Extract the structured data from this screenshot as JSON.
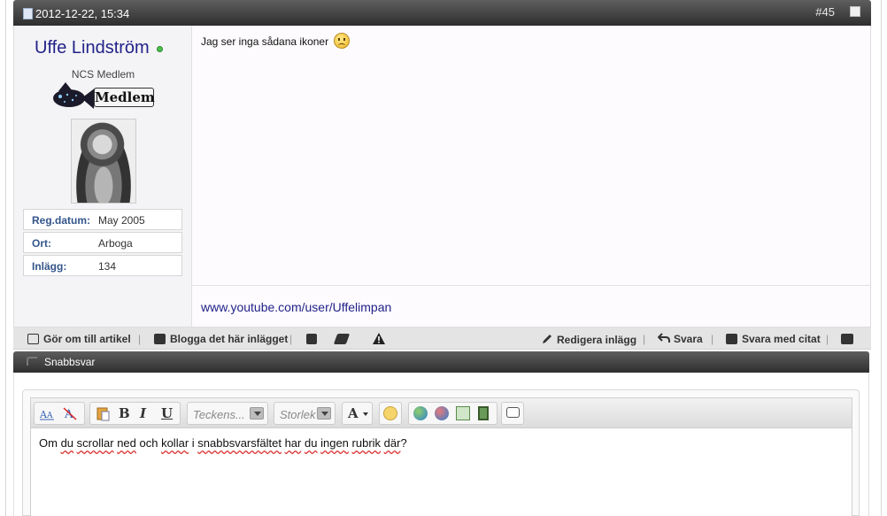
{
  "post": {
    "date": "2012-12-22, 15:34",
    "number": "#45",
    "username": "Uffe Lindström",
    "usertitle": "NCS Medlem",
    "rank_text": "Medlem",
    "stats": [
      {
        "label": "Reg.datum:",
        "value": "May 2005"
      },
      {
        "label": "Ort:",
        "value": "Arboga"
      },
      {
        "label": "Inlägg:",
        "value": "134"
      }
    ],
    "message": "Jag ser inga sådana ikoner",
    "signature_link": "www.youtube.com/user/Uffelimpan"
  },
  "actions": {
    "make_article": "Gör om till artikel",
    "blog_post": "Blogga det här inlägget",
    "edit": "Redigera inlägg",
    "reply": "Svara",
    "reply_quote": "Svara med citat"
  },
  "quick_reply": {
    "title": "Snabbsvar",
    "font_placeholder": "Teckens...",
    "size_placeholder": "Storlek",
    "text_parts": [
      "Om ",
      "du",
      " ",
      "scrollar",
      " ",
      "ned",
      " och ",
      "kollar",
      " i ",
      "snabbsvarsfältet",
      " ",
      "har",
      " ",
      "du",
      " ",
      "ingen",
      " ",
      "rubrik",
      " ",
      "där",
      "?"
    ]
  },
  "colors": {
    "header_bar": "#3f3f3f",
    "username": "#22228a",
    "stat_label": "#33558a"
  },
  "icons": [
    "document-icon",
    "checkbox-icon",
    "online-icon",
    "sad-smiley-icon",
    "article-icon",
    "blog-icon",
    "ip-icon",
    "infraction-icon",
    "warning-icon",
    "edit-icon",
    "reply-icon",
    "quote-icon",
    "multiquote-icon",
    "collapse-icon"
  ]
}
